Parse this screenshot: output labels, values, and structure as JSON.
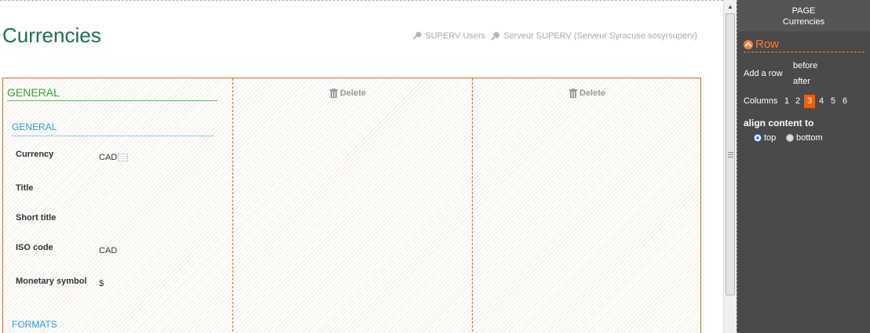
{
  "page": {
    "title": "Currencies",
    "header_links": [
      {
        "label": "SUPERV Users"
      },
      {
        "label": "Serveur SUPERV (Serveur Syracuse sosyrsuperv)"
      }
    ]
  },
  "row": {
    "delete_label": "Delete",
    "section_title": "GENERAL",
    "groups": [
      {
        "title": "GENERAL"
      },
      {
        "title": "FORMATS"
      }
    ],
    "fields": [
      {
        "label": "Currency",
        "value": "CAD"
      },
      {
        "label": "Title",
        "value": ""
      },
      {
        "label": "Short title",
        "value": ""
      },
      {
        "label": "ISO code",
        "value": "CAD"
      },
      {
        "label": "Monetary symbol",
        "value": "$"
      }
    ]
  },
  "panel": {
    "header_line1": "PAGE",
    "header_line2": "Currencies",
    "row_title": "Row",
    "add_row_label": "Add a row",
    "before_label": "before",
    "after_label": "after",
    "columns_label": "Columns",
    "column_options": [
      "1",
      "2",
      "3",
      "4",
      "5",
      "6"
    ],
    "active_column": "3",
    "align_label": "align content to",
    "align_options": [
      "top",
      "bottom"
    ],
    "align_selected": "top"
  },
  "colors": {
    "title": "#1e6e59",
    "row_border": "#d2691e",
    "section_green": "#2fa33a",
    "group_blue": "#2b9fcf",
    "panel_bg": "#4a4a4a",
    "accent_orange": "#ff5a00"
  }
}
